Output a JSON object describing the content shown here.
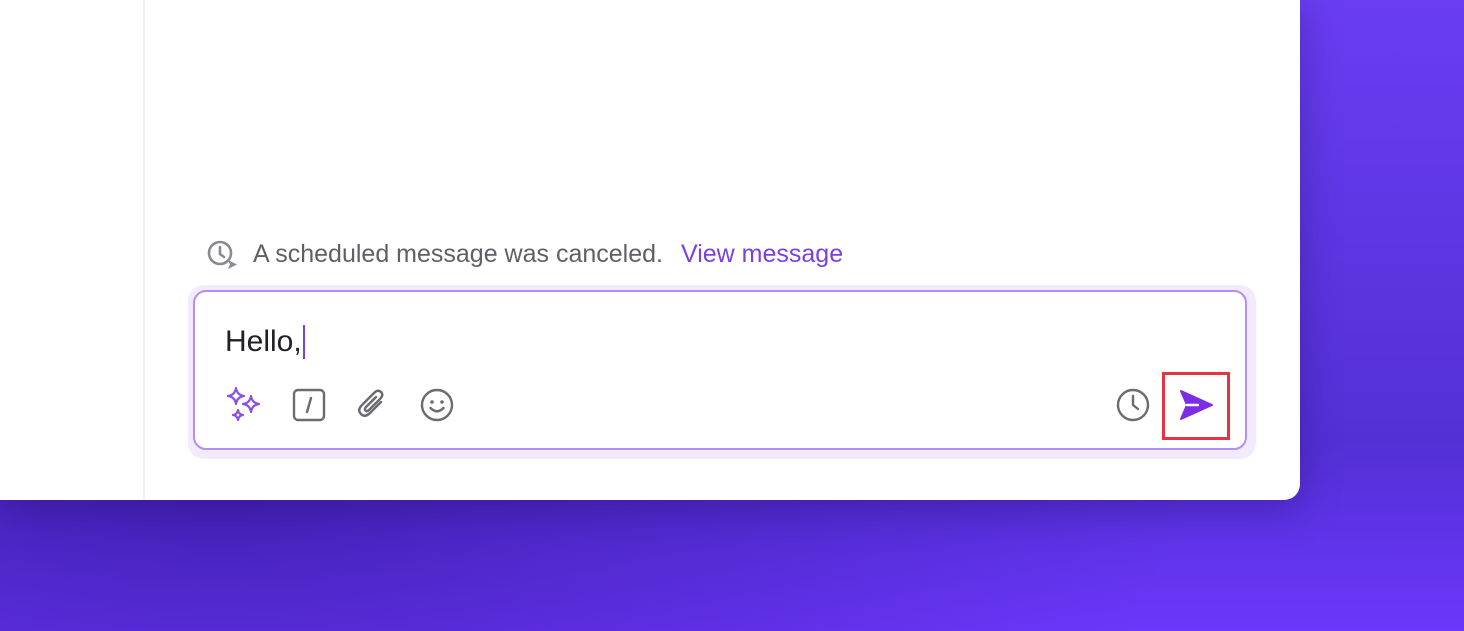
{
  "notice": {
    "text": "A scheduled message was canceled.",
    "link_label": "View message",
    "icon": "clock-arrow-icon"
  },
  "composer": {
    "value": "Hello,",
    "tools": [
      {
        "name": "ai-sparkle-icon",
        "color": "#8b4ee8"
      },
      {
        "name": "slash-command-icon",
        "color": "#6b6b70"
      },
      {
        "name": "paperclip-icon",
        "color": "#6b6b70"
      },
      {
        "name": "emoji-icon",
        "color": "#6b6b70"
      }
    ],
    "schedule_icon": "clock-icon",
    "send_icon": "send-icon"
  },
  "colors": {
    "accent": "#7b3fe4",
    "background": "#6437f5",
    "highlight": "#e5343f"
  }
}
